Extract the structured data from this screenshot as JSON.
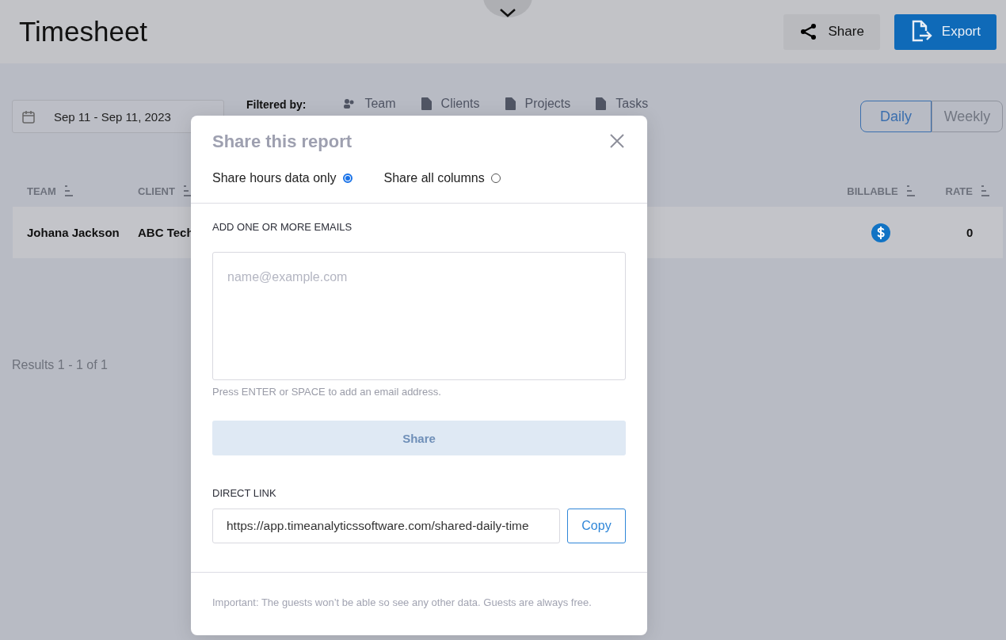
{
  "header": {
    "title": "Timesheet",
    "buttons": [
      {
        "kind": "share",
        "label": "Share"
      },
      {
        "kind": "export",
        "label": "Export"
      }
    ]
  },
  "date_range": {
    "value": "Sep 11 - Sep 11, 2023"
  },
  "filters": {
    "label": "Filtered by:",
    "items": [
      {
        "kind": "team",
        "label": "Team"
      },
      {
        "kind": "doc",
        "label": "Clients"
      },
      {
        "kind": "doc",
        "label": "Projects"
      },
      {
        "kind": "doc",
        "label": "Tasks"
      }
    ]
  },
  "view_toggle": [
    {
      "label": "Daily",
      "selected": true
    },
    {
      "label": "Weekly",
      "selected": false
    }
  ],
  "table": {
    "columns": [
      {
        "label": "TEAM"
      },
      {
        "label": "CLIENT"
      },
      {
        "label": "BILLABLE"
      },
      {
        "label": "RATE"
      }
    ],
    "rows": [
      {
        "team": "Johana Jackson",
        "client": "ABC Tech",
        "billable": true,
        "rate": "0"
      }
    ]
  },
  "results": "Results 1 - 1 of 1",
  "dialog": {
    "title": "Share this report",
    "options": [
      {
        "label": "Share hours data only",
        "selected": true
      },
      {
        "label": "Share all columns",
        "selected": false
      }
    ],
    "emails_label": "ADD ONE OR MORE EMAILS",
    "emails_placeholder": "name@example.com",
    "hint": "Press ENTER or SPACE to add an email address.",
    "share_button": {
      "label": "Share",
      "disabled": true
    },
    "link_label": "DIRECT LINK",
    "link_value": "https://app.timeanalyticssoftware.com/shared-daily-time",
    "copy_button": "Copy",
    "footer": "Important: The guests won’t be able so see any other data. Guests are always free."
  }
}
